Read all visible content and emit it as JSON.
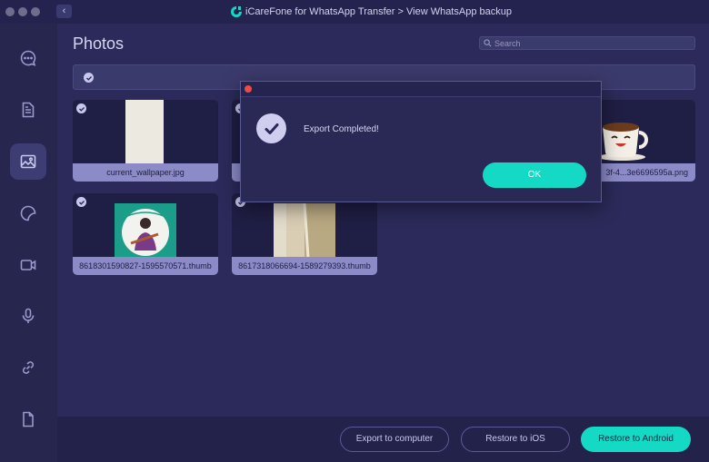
{
  "app": {
    "title": "iCareFone for WhatsApp Transfer > View WhatsApp backup",
    "back_label": "‹"
  },
  "sidebar": {
    "items": [
      {
        "name": "messages-icon",
        "active": false
      },
      {
        "name": "document-icon",
        "active": false
      },
      {
        "name": "photos-icon",
        "active": true
      },
      {
        "name": "sticker-icon",
        "active": false
      },
      {
        "name": "video-icon",
        "active": false
      },
      {
        "name": "microphone-icon",
        "active": false
      },
      {
        "name": "link-icon",
        "active": false
      },
      {
        "name": "file-icon",
        "active": false
      }
    ]
  },
  "main": {
    "title": "Photos",
    "search": {
      "placeholder": "Search",
      "value": ""
    },
    "photos": [
      {
        "caption": "current_wallpaper.jpg",
        "checked": true
      },
      {
        "caption": "",
        "checked": true
      },
      {
        "caption": "3f-4...3e6696595a.png",
        "checked": true
      },
      {
        "caption": "8618301590827-1595570571.thumb",
        "checked": true
      },
      {
        "caption": "8617318066694-1589279393.thumb",
        "checked": true
      }
    ]
  },
  "actions": {
    "export_computer": "Export to computer",
    "restore_ios": "Restore to iOS",
    "restore_android": "Restore to Android"
  },
  "dialog": {
    "message": "Export Completed!",
    "ok_label": "OK"
  },
  "colors": {
    "accent": "#14d9c4",
    "background": "#2b2a5a",
    "sidebar": "#27264f"
  }
}
